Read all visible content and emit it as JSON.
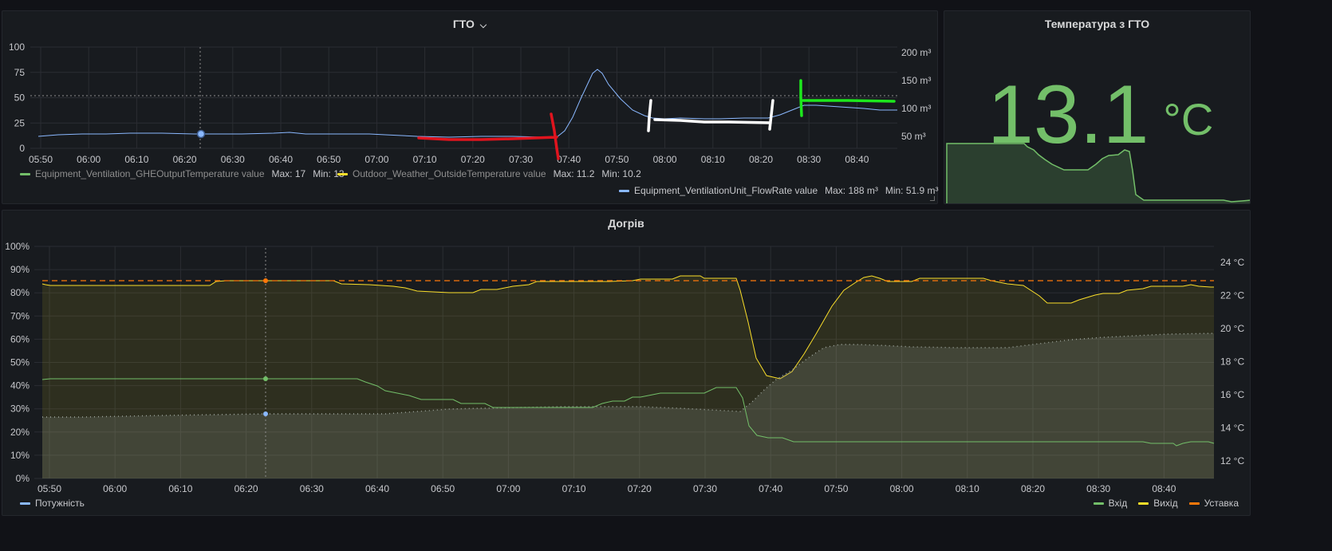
{
  "gto": {
    "title": "ГТО",
    "title_chevron": "⌵",
    "y_left": [
      "100",
      "75",
      "50",
      "25",
      "0"
    ],
    "y_right": [
      "200 m³",
      "150 m³",
      "100 m³",
      "50 m³"
    ],
    "x_ticks": [
      "05:50",
      "06:00",
      "06:10",
      "06:20",
      "06:30",
      "06:40",
      "06:50",
      "07:00",
      "07:10",
      "07:20",
      "07:30",
      "07:40",
      "07:50",
      "08:00",
      "08:10",
      "08:20",
      "08:30",
      "08:40"
    ],
    "legend": [
      {
        "name": "Equipment_Ventilation_GHEOutputTemperature value",
        "color": "#73bf69",
        "max": "Max: 17",
        "min": "Min: 13"
      },
      {
        "name": "Outdoor_Weather_OutsideTemperature value",
        "color": "#fade2a",
        "max": "Max: 11.2",
        "min": "Min: 10.2"
      },
      {
        "name": "Equipment_VentilationUnit_FlowRate value",
        "color": "#8ab8ff",
        "max": "Max: 188 m³",
        "min": "Min: 51.9 m³"
      }
    ]
  },
  "temp": {
    "title": "Температура з ГТО",
    "value": "13.1",
    "unit": "°C",
    "color": "#73bf69"
  },
  "dogriv": {
    "title": "Догрів",
    "y_left": [
      "100%",
      "90%",
      "80%",
      "70%",
      "60%",
      "50%",
      "40%",
      "30%",
      "20%",
      "10%",
      "0%"
    ],
    "y_right": [
      "24 °C",
      "22 °C",
      "20 °C",
      "18 °C",
      "16 °C",
      "14 °C",
      "12 °C"
    ],
    "x_ticks": [
      "05:50",
      "06:00",
      "06:10",
      "06:20",
      "06:30",
      "06:40",
      "06:50",
      "07:00",
      "07:10",
      "07:20",
      "07:30",
      "07:40",
      "07:50",
      "08:00",
      "08:10",
      "08:20",
      "08:30",
      "08:40"
    ],
    "legend_left": [
      {
        "name": "Потужність",
        "color": "#8ab8ff"
      }
    ],
    "legend_right": [
      {
        "name": "Вхід",
        "color": "#73bf69"
      },
      {
        "name": "Вихід",
        "color": "#fade2a"
      },
      {
        "name": "Уставка",
        "color": "#ff780a"
      }
    ]
  }
}
